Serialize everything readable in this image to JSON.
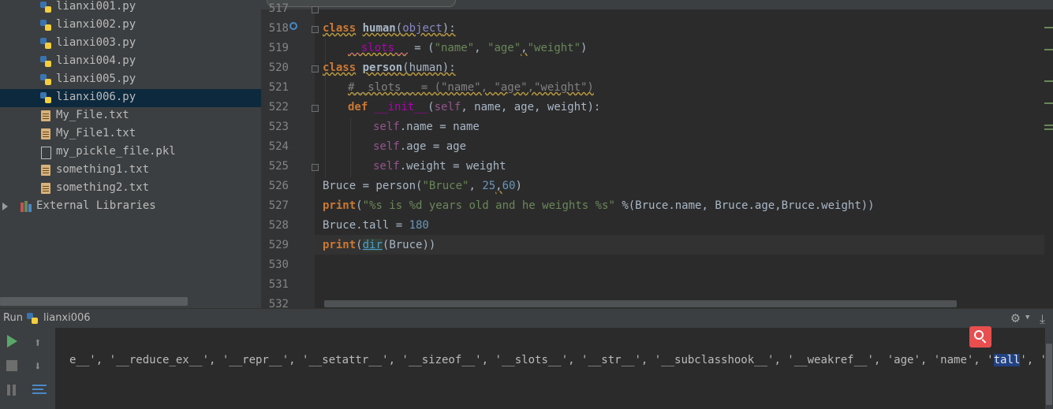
{
  "project_tree": {
    "files": [
      {
        "name": "lianxi001.py",
        "type": "python"
      },
      {
        "name": "lianxi002.py",
        "type": "python"
      },
      {
        "name": "lianxi003.py",
        "type": "python"
      },
      {
        "name": "lianxi004.py",
        "type": "python"
      },
      {
        "name": "lianxi005.py",
        "type": "python"
      },
      {
        "name": "lianxi006.py",
        "type": "python",
        "selected": true
      },
      {
        "name": "My_File.txt",
        "type": "text"
      },
      {
        "name": "My_File1.txt",
        "type": "text"
      },
      {
        "name": "my_pickle_file.pkl",
        "type": "pickle"
      },
      {
        "name": "something1.txt",
        "type": "text"
      },
      {
        "name": "something2.txt",
        "type": "text"
      }
    ],
    "external_libraries": "External Libraries"
  },
  "editor": {
    "line_numbers": [
      "517",
      "518",
      "519",
      "520",
      "521",
      "522",
      "523",
      "524",
      "525",
      "526",
      "527",
      "528",
      "529",
      "530",
      "531",
      "532"
    ],
    "code": {
      "l518": {
        "kw": "class",
        "name": "human",
        "base": "object"
      },
      "l519": {
        "slots": "__slots__",
        "op": " = (",
        "s1": "\"name\"",
        "s2": "\"age\"",
        "s3": "\"weight\"",
        "close": ")"
      },
      "l520": {
        "kw": "class",
        "name": "person",
        "base": "human"
      },
      "l521": {
        "comment": "#__slots__ = (\"name\", \"age\",\"weight\")"
      },
      "l522": {
        "kw": "def",
        "fn": "__init__",
        "params": "self",
        "rest": ", name, age, weight):"
      },
      "l523": {
        "self": "self",
        "rest": ".name = name"
      },
      "l524": {
        "self": "self",
        "rest": ".age = age"
      },
      "l525": {
        "self": "self",
        "rest": ".weight = weight"
      },
      "l526": {
        "pre": "Bruce = person(",
        "s1": "\"Bruce\"",
        "n1": "25",
        "n2": "60",
        "close": ")"
      },
      "l527": {
        "fn": "print",
        "str": "\"%s is %d years old and he weights %s\"",
        "rest": " %(Bruce.name, Bruce.age,Bruce.weight))"
      },
      "l528": {
        "pre": "Bruce.tall = ",
        "num": "180"
      },
      "l529": {
        "fn": "print",
        "builtin": "dir",
        "rest": "(Bruce))"
      }
    }
  },
  "run_panel": {
    "tab_label": "Run",
    "config_name": "lianxi006",
    "console": {
      "before_selection": "e__', '__reduce_ex__', '__repr__', '__setattr__', '__sizeof__', '__slots__', '__str__', '__subclasshook__', '__weakref__', 'age', 'name', '",
      "selection": "tall",
      "after_selection": "', 'weight']"
    }
  },
  "colors": {
    "accent_selection": "#0d293e",
    "keyword": "#cc7832",
    "string": "#6a8759",
    "number": "#6897bb",
    "self": "#94558d",
    "run_green": "#59a869",
    "search_red": "#e84e4e"
  },
  "icons": [
    "python-file-icon",
    "text-file-icon",
    "pickle-file-icon",
    "library-icon",
    "rerun-icon",
    "stop-icon",
    "pause-icon",
    "scroll-up-icon",
    "scroll-down-icon",
    "soft-wrap-icon",
    "gear-icon",
    "search-icon"
  ]
}
